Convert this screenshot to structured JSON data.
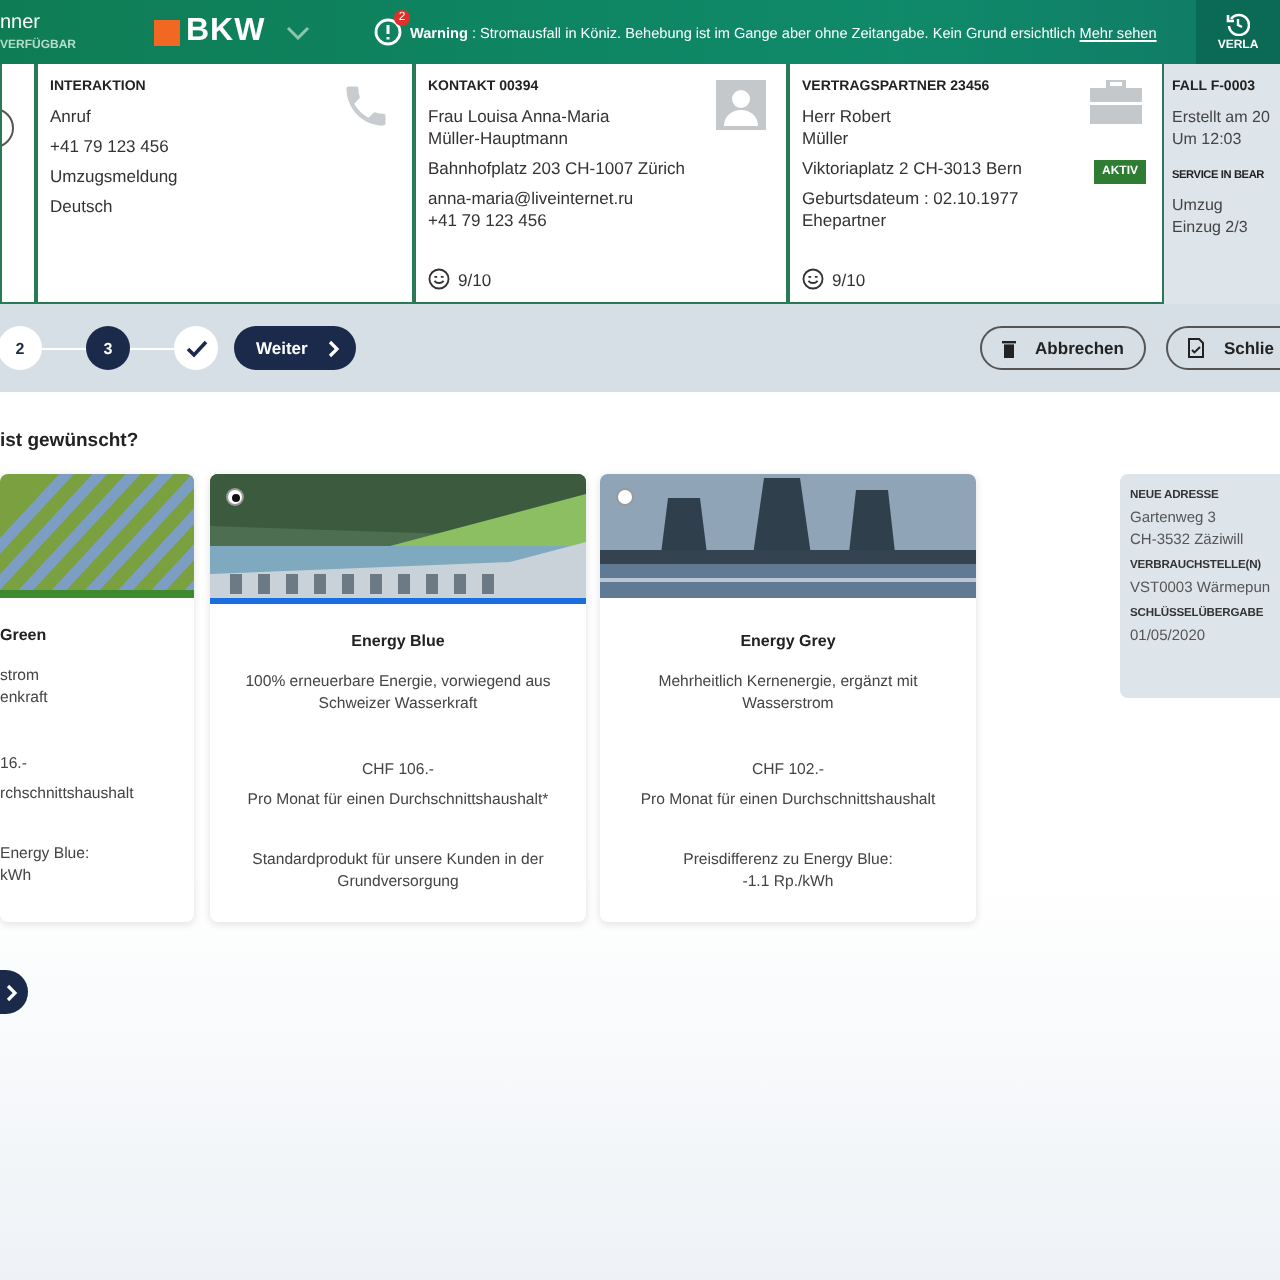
{
  "header": {
    "user_name": "nner",
    "user_status": "VERFÜGBAR",
    "logo": "BKW",
    "alert_count": "2",
    "warning_label": "Warning",
    "warning_text": " : Stromausfall in Köniz. Behebung ist im Gange aber ohne Zeitangabe. Kein Grund ersichtlich ",
    "warning_link": "Mehr sehen",
    "history_label": "VERLA"
  },
  "interaction": {
    "title": "INTERAKTION",
    "lines": [
      "Anruf",
      "+41 79 123 456",
      "Umzugsmeldung",
      "Deutsch"
    ]
  },
  "contact": {
    "title": "KONTAKT 00394",
    "name": "Frau Louisa Anna-Maria Müller-Hauptmann",
    "address": "Bahnhofplatz 203 CH-1007 Zürich",
    "email": "anna-maria@liveinternet.ru",
    "phone": "+41 79 123 456",
    "score": "9/10"
  },
  "partner": {
    "title": "VERTRAGSPARTNER 23456",
    "name": "Herr Robert Müller",
    "address": "Viktoriaplatz 2 CH-3013 Bern",
    "birth": "Geburtsdateum : 02.10.1977",
    "relation": "Ehepartner",
    "status": "AKTIV",
    "score": "9/10"
  },
  "case": {
    "title": "FALL F-0003",
    "created": "Erstellt am 20",
    "time": "Um 12:03",
    "service_title": "SERVICE IN BEAR",
    "service_lines": [
      "Umzug",
      "Einzug 2/3"
    ]
  },
  "steps": [
    {
      "kind": "number",
      "label": "2",
      "selected": false
    },
    {
      "kind": "number",
      "label": "3",
      "selected": true
    },
    {
      "kind": "check",
      "selected": false
    }
  ],
  "next_button": "Weiter",
  "cancel_button": "Abbrechen",
  "close_button": "Schlie",
  "question": "ist gewünscht?",
  "products": [
    {
      "name": "Green",
      "description": "strom\nenkraft",
      "price": "16.-",
      "price_note": "rchschnittshaushalt",
      "extra": " Energy Blue:\nkWh"
    },
    {
      "name": "Energy Blue",
      "description": "100% erneuerbare Energie, vorwiegend aus Schweizer Wasserkraft",
      "price": "CHF 106.-",
      "price_note": "Pro Monat für einen Durchschnittshaushalt*",
      "extra": "Standardprodukt für unsere Kunden in der Grundversorgung",
      "selected": true
    },
    {
      "name": "Energy Grey",
      "description": "Mehrheitlich Kernenergie, ergänzt mit Wasserstrom",
      "price": "CHF 102.-",
      "price_note": "Pro Monat für einen Durchschnittshaushalt",
      "extra": "Preisdifferenz zu Energy Blue:\n-1.1 Rp./kWh",
      "selected": false
    }
  ],
  "summary": [
    {
      "label": "NEUE ADRESSE",
      "lines": [
        "Gartenweg 3",
        "CH-3532 Zäziwill"
      ]
    },
    {
      "label": "VERBRAUCHSTELLE(N)",
      "lines": [
        "VST0003 Wärmepun"
      ]
    },
    {
      "label": "SCHLÜSSELÜBERGABE",
      "lines": [
        "01/05/2020"
      ]
    }
  ]
}
